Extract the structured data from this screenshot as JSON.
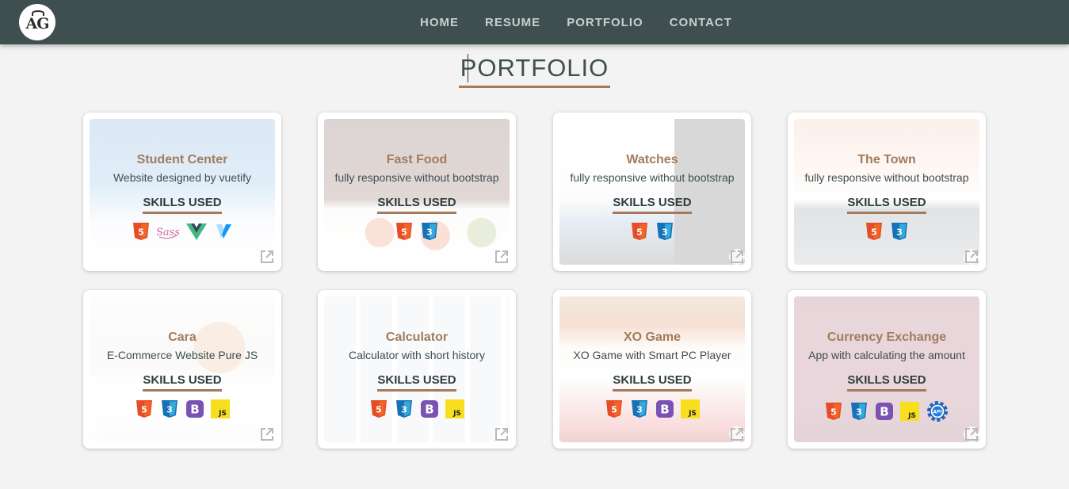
{
  "nav": {
    "logo_text": "AG",
    "links": [
      "HOME",
      "RESUME",
      "PORTFOLIO",
      "CONTACT"
    ]
  },
  "page": {
    "title": "PORTFOLIO"
  },
  "colors": {
    "nav_bg": "#3f4e4f",
    "accent": "#a27b5c",
    "page_bg": "#f3f3f3"
  },
  "projects": [
    {
      "title": "Student Center",
      "description": "Website designed by vuetify",
      "skills_label": "SKILLS USED",
      "skills": [
        "html5-icon",
        "sass-icon",
        "vue-icon",
        "vuetify-icon"
      ]
    },
    {
      "title": "Fast Food",
      "description": "fully responsive without bootstrap",
      "skills_label": "SKILLS USED",
      "skills": [
        "html5-icon",
        "css3-icon"
      ]
    },
    {
      "title": "Watches",
      "description": "fully responsive without bootstrap",
      "skills_label": "SKILLS USED",
      "skills": [
        "html5-icon",
        "css3-icon"
      ]
    },
    {
      "title": "The Town",
      "description": "fully responsive without bootstrap",
      "skills_label": "SKILLS USED",
      "skills": [
        "html5-icon",
        "css3-icon"
      ]
    },
    {
      "title": "Cara",
      "description": "E-Commerce Website Pure JS",
      "skills_label": "SKILLS USED",
      "skills": [
        "html5-icon",
        "css3-icon",
        "bootstrap-icon",
        "js-icon"
      ]
    },
    {
      "title": "Calculator",
      "description": "Calculator with short history",
      "skills_label": "SKILLS USED",
      "skills": [
        "html5-icon",
        "css3-icon",
        "bootstrap-icon",
        "js-icon"
      ]
    },
    {
      "title": "XO Game",
      "description": "XO Game with Smart PC Player",
      "skills_label": "SKILLS USED",
      "skills": [
        "html5-icon",
        "css3-icon",
        "bootstrap-icon",
        "js-icon"
      ]
    },
    {
      "title": "Currency Exchange",
      "description": "App with calculating the amount",
      "skills_label": "SKILLS USED",
      "skills": [
        "html5-icon",
        "css3-icon",
        "bootstrap-icon",
        "js-icon",
        "api-icon"
      ]
    }
  ]
}
